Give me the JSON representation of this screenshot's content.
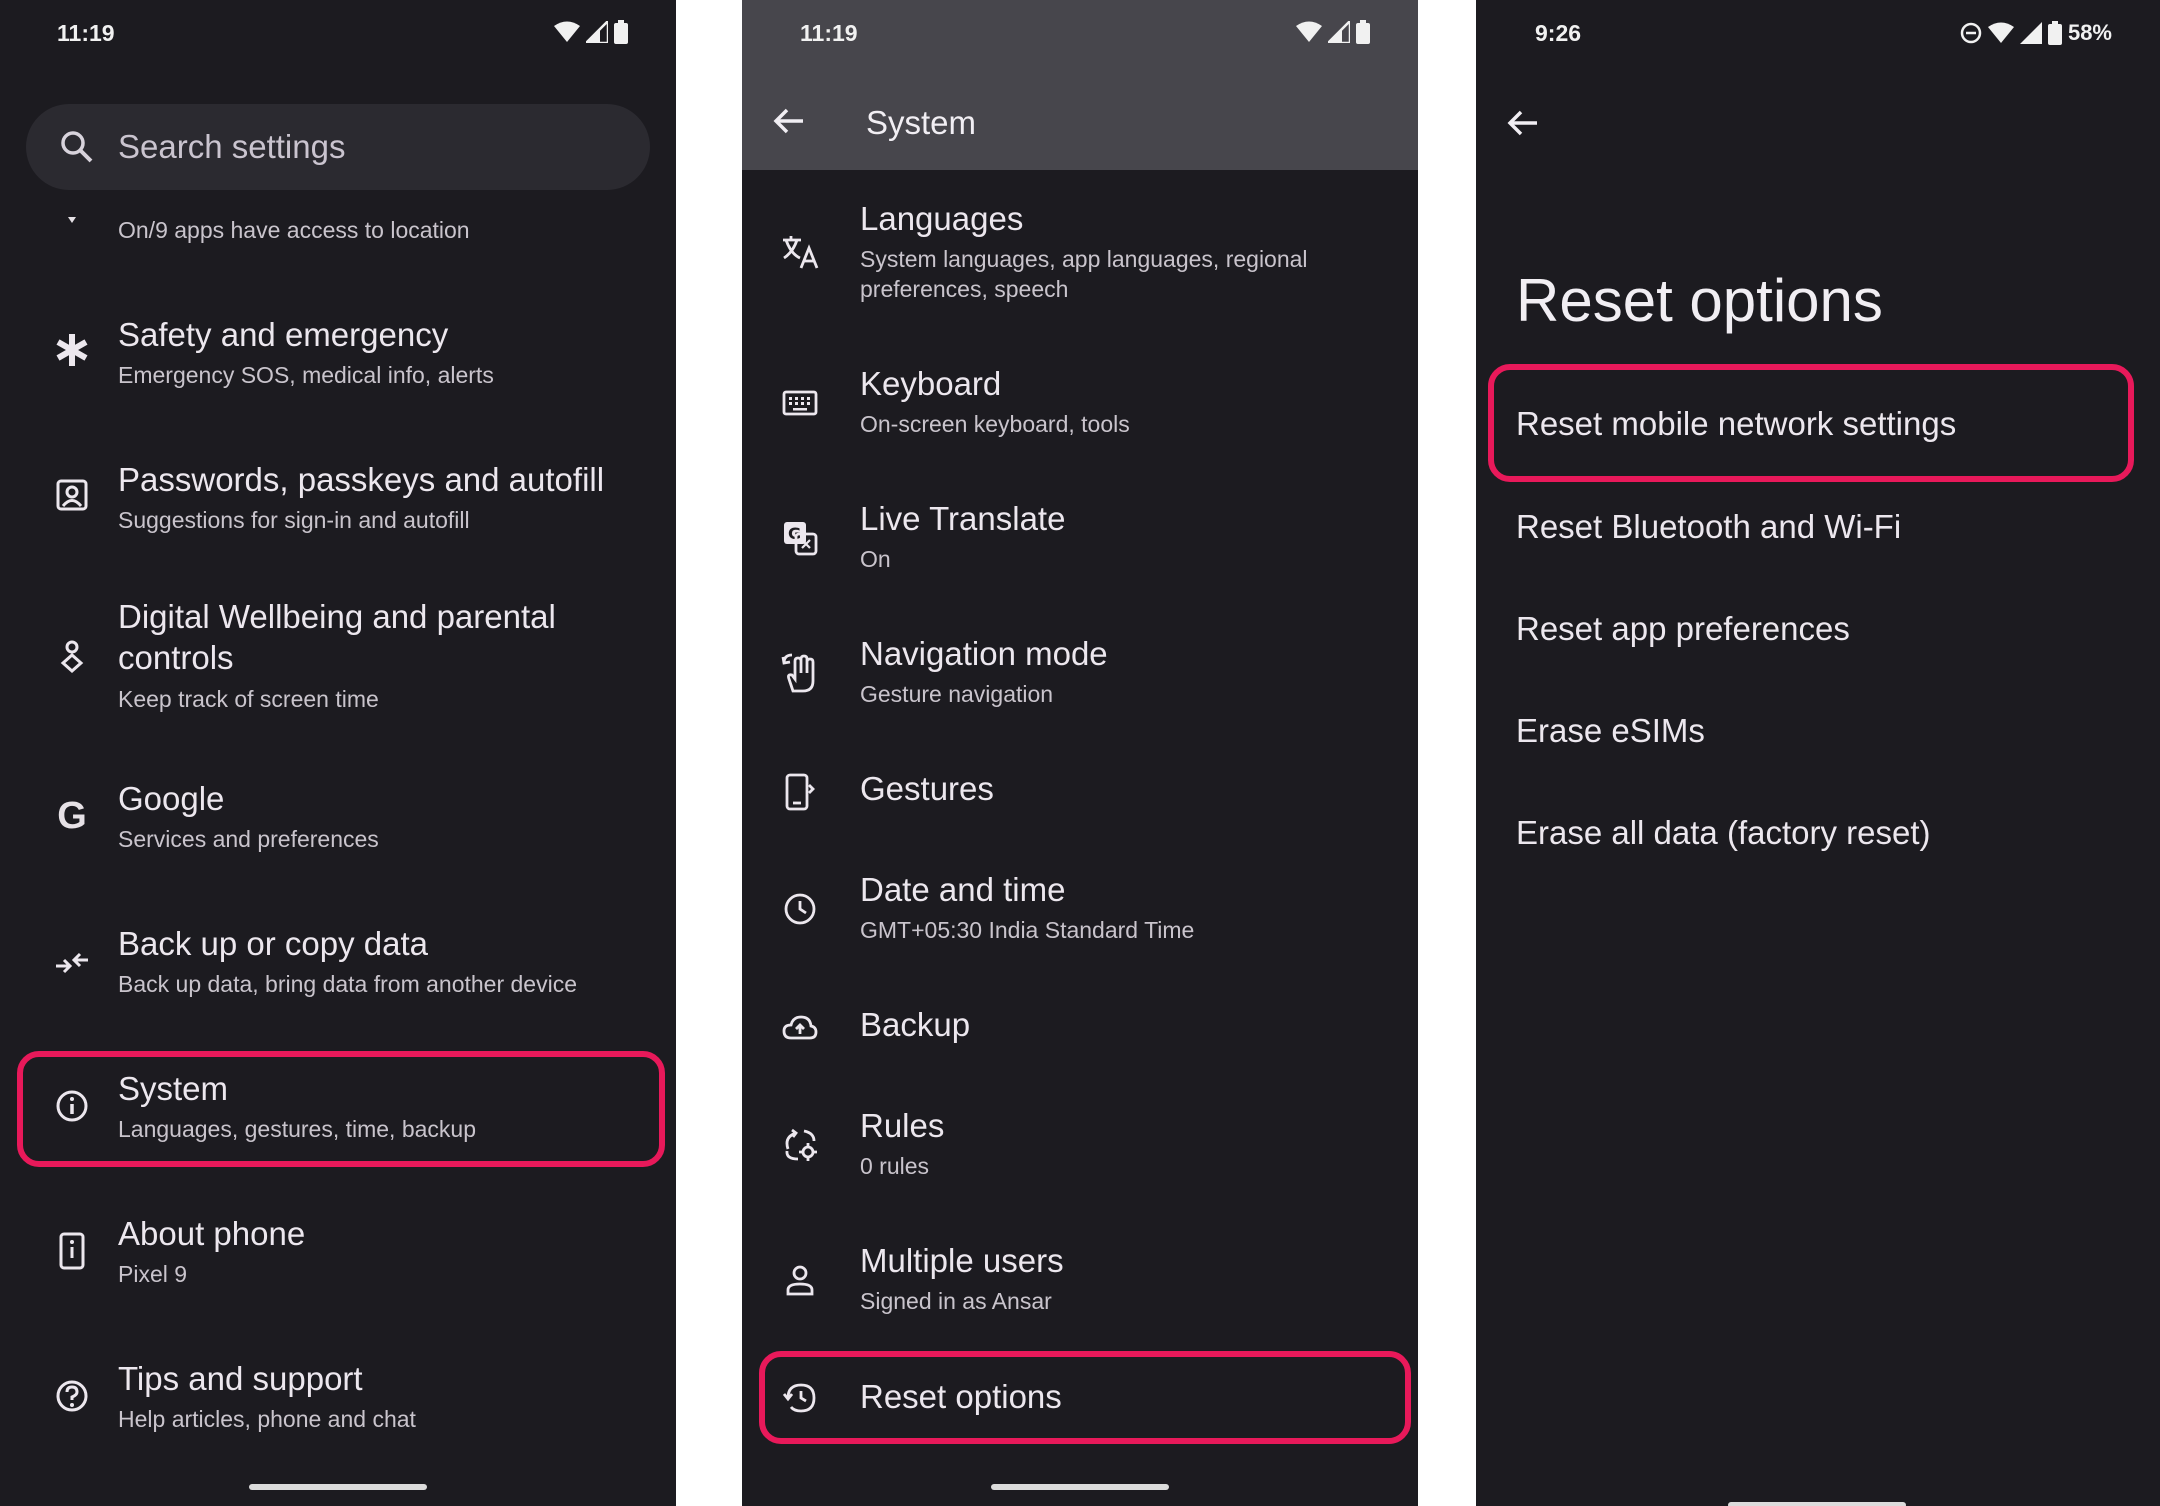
{
  "screen1": {
    "status_time": "11:19",
    "search_placeholder": "Search settings",
    "partial_item_sub": "On/9 apps have access to location",
    "items": [
      {
        "title": "Safety and emergency",
        "sub": "Emergency SOS, medical info, alerts",
        "icon": "asterisk-icon"
      },
      {
        "title": "Passwords, passkeys and autofill",
        "sub": "Suggestions for sign-in and autofill",
        "icon": "account-box-icon"
      },
      {
        "title": "Digital Wellbeing and parental controls",
        "sub": "Keep track of screen time",
        "icon": "wellbeing-icon"
      },
      {
        "title": "Google",
        "sub": "Services and preferences",
        "icon": "google-g-icon"
      },
      {
        "title": "Back up or copy data",
        "sub": "Back up data, bring data from another device",
        "icon": "backup-transfer-icon"
      },
      {
        "title": "System",
        "sub": "Languages, gestures, time, backup",
        "icon": "info-icon"
      },
      {
        "title": "About phone",
        "sub": "Pixel 9",
        "icon": "phone-info-icon"
      },
      {
        "title": "Tips and support",
        "sub": "Help articles, phone and chat",
        "icon": "help-icon"
      }
    ]
  },
  "screen2": {
    "status_time": "11:19",
    "title": "System",
    "items": [
      {
        "title": "Languages",
        "sub": "System languages, app languages, regional preferences, speech",
        "icon": "translate-icon"
      },
      {
        "title": "Keyboard",
        "sub": "On-screen keyboard, tools",
        "icon": "keyboard-icon"
      },
      {
        "title": "Live Translate",
        "sub": "On",
        "icon": "live-translate-icon"
      },
      {
        "title": "Navigation mode",
        "sub": "Gesture navigation",
        "icon": "gesture-hand-icon"
      },
      {
        "title": "Gestures",
        "sub": "",
        "icon": "phone-gesture-icon"
      },
      {
        "title": "Date and time",
        "sub": "GMT+05:30 India Standard Time",
        "icon": "clock-icon"
      },
      {
        "title": "Backup",
        "sub": "",
        "icon": "cloud-upload-icon"
      },
      {
        "title": "Rules",
        "sub": "0 rules",
        "icon": "rules-icon"
      },
      {
        "title": "Multiple users",
        "sub": "Signed in as Ansar",
        "icon": "person-icon"
      },
      {
        "title": "Reset options",
        "sub": "",
        "icon": "history-icon"
      }
    ]
  },
  "screen3": {
    "status_time": "9:26",
    "battery": "58%",
    "title": "Reset options",
    "options": [
      "Reset mobile network settings",
      "Reset Bluetooth and Wi-Fi",
      "Reset app preferences",
      "Erase eSIMs",
      "Erase all data (factory reset)"
    ]
  },
  "colors": {
    "background": "#1c1b20",
    "appbar": "#47464c",
    "highlight": "#e8195a",
    "search": "#2b2a30"
  }
}
